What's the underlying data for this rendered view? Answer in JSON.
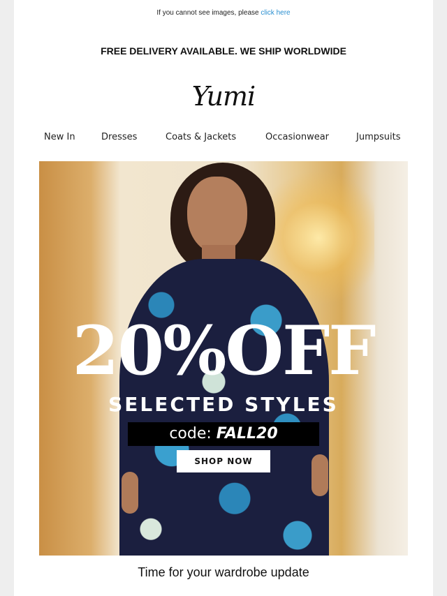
{
  "preheader": {
    "text": "If you cannot see images, please ",
    "link": "click here"
  },
  "banner": {
    "delivery": "FREE DELIVERY AVAILABLE. WE SHIP WORLDWIDE"
  },
  "brand": {
    "logo": "Yumi"
  },
  "nav": {
    "items": [
      "New In",
      "Dresses",
      "Coats & Jackets",
      "Occasionwear",
      "Jumpsuits"
    ]
  },
  "hero": {
    "discount": "20%OFF",
    "subtitle": "SELECTED STYLES",
    "code_label": "code: ",
    "code_value": "FALL20",
    "cta": "SHOP NOW"
  },
  "footer": {
    "tagline": "Time for your wardrobe update"
  },
  "colors": {
    "link": "#2a8fd0",
    "page_bg": "#eeeeee",
    "code_box": "#000000"
  }
}
